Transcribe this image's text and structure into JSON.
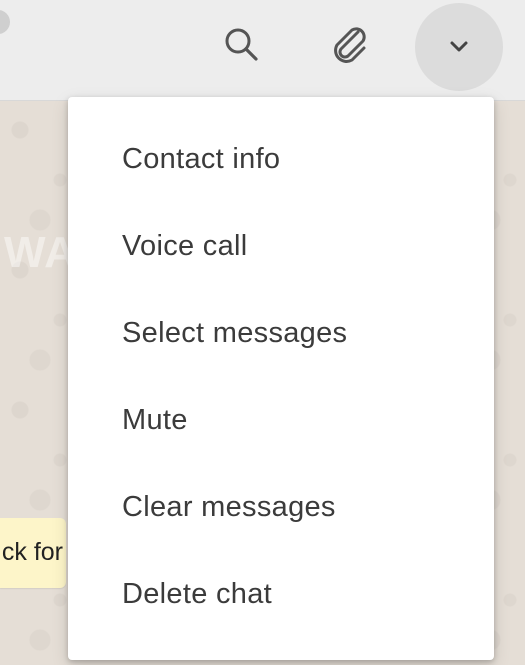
{
  "header": {
    "icons": {
      "search": "search-icon",
      "attach": "paperclip-icon",
      "menu": "chevron-down-icon"
    }
  },
  "watermark": "WABetaInfo",
  "chat": {
    "bubble_text": "ck for"
  },
  "menu": {
    "items": [
      {
        "label": "Contact info"
      },
      {
        "label": "Voice call"
      },
      {
        "label": "Select messages"
      },
      {
        "label": "Mute"
      },
      {
        "label": "Clear messages"
      },
      {
        "label": "Delete chat"
      }
    ]
  },
  "colors": {
    "header_bg": "#ededed",
    "menu_bg": "#ffffff",
    "menu_text": "#3b3b3b",
    "icon": "#555555",
    "bubble_bg": "#fdf5c9"
  }
}
